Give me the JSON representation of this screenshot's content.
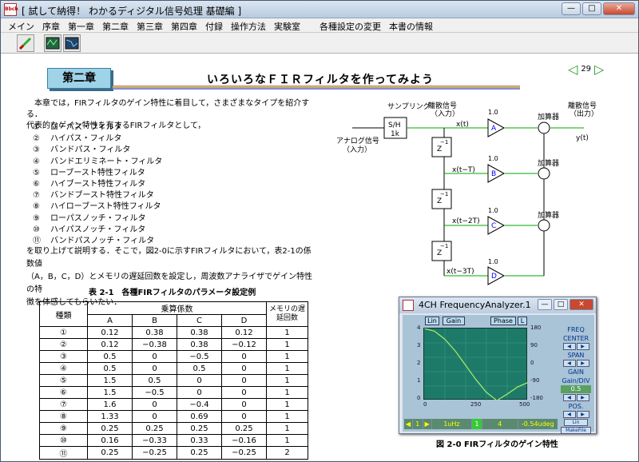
{
  "window": {
    "title": "[ 試して納得！ わかるディジタル信号処理 基礎編 ]",
    "app_icon_text": "Bbch",
    "min": "—",
    "max": "□",
    "close": "✕"
  },
  "menu": [
    {
      "label": "メイン"
    },
    {
      "label": "序章"
    },
    {
      "label": "第一章"
    },
    {
      "label": "第二章"
    },
    {
      "label": "第三章"
    },
    {
      "label": "第四章"
    },
    {
      "label": "付録"
    },
    {
      "label": "操作方法"
    },
    {
      "label": "実験室"
    },
    {
      "label": "各種設定の変更"
    },
    {
      "label": "本書の情報"
    }
  ],
  "page": {
    "chapter": "第二章",
    "title": "いろいろなＦＩＲフィルタを作ってみよう",
    "page_number": "29",
    "prev": "◁",
    "next": "▷"
  },
  "intro": [
    "本章では，FIRフィルタのゲイン特性に着目して，さまざまなタイプを紹介する．",
    "代表的なゲイン特性を有するFIRフィルタとして，"
  ],
  "filters": [
    {
      "n": "①",
      "name": "ローパス・フィルタ"
    },
    {
      "n": "②",
      "name": "ハイパス・フィルタ"
    },
    {
      "n": "③",
      "name": "バンドパス・フィルタ"
    },
    {
      "n": "④",
      "name": "バンドエリミネート・フィルタ"
    },
    {
      "n": "⑤",
      "name": "ローブースト特性フィルタ"
    },
    {
      "n": "⑥",
      "name": "ハイブースト特性フィルタ"
    },
    {
      "n": "⑦",
      "name": "バンドブースト特性フィルタ"
    },
    {
      "n": "⑧",
      "name": "ハイローブースト特性フィルタ"
    },
    {
      "n": "⑨",
      "name": "ローパスノッチ・フィルタ"
    },
    {
      "n": "⑩",
      "name": "ハイパスノッチ・フィルタ"
    },
    {
      "n": "⑪",
      "name": "バンドパスノッチ・フィルタ"
    }
  ],
  "after": [
    "を取り上げて説明する．そこで，図2-0に示すFIRフィルタにおいて，表2-1の係数値",
    "（A，B，C，D）とメモリの遅延回数を設定し，周波数アナライザでゲイン特性の特",
    "徴を体感してもらいたい．"
  ],
  "table": {
    "caption": "表 2-1　各種FIRフィルタのパラメータ設定例",
    "h_kind": "種類",
    "h_coef": "乗算係数",
    "h_mem": "メモリの遅延回数",
    "cols": [
      "A",
      "B",
      "C",
      "D"
    ],
    "rows": [
      [
        "①",
        "0.12",
        "0.38",
        "0.38",
        "0.12",
        "1"
      ],
      [
        "②",
        "0.12",
        "−0.38",
        "0.38",
        "−0.12",
        "1"
      ],
      [
        "③",
        "0.5",
        "0",
        "−0.5",
        "0",
        "1"
      ],
      [
        "④",
        "0.5",
        "0",
        "0.5",
        "0",
        "1"
      ],
      [
        "⑤",
        "1.5",
        "0.5",
        "0",
        "0",
        "1"
      ],
      [
        "⑥",
        "1.5",
        "−0.5",
        "0",
        "0",
        "1"
      ],
      [
        "⑦",
        "1.6",
        "0",
        "−0.4",
        "0",
        "1"
      ],
      [
        "⑧",
        "1.33",
        "0",
        "0.69",
        "0",
        "1"
      ],
      [
        "⑨",
        "0.25",
        "0.25",
        "0.25",
        "0.25",
        "1"
      ],
      [
        "⑩",
        "0.16",
        "−0.33",
        "0.33",
        "−0.16",
        "1"
      ],
      [
        "⑪",
        "0.25",
        "−0.25",
        "0.25",
        "−0.25",
        "2"
      ]
    ]
  },
  "diagram": {
    "sampling": "サンプリング",
    "sh": "S/H",
    "sh_rate": "1k",
    "analog": "アナログ信号",
    "analog_sub": "（入力）",
    "discrete_in": "離散信号",
    "discrete_in_sub": "（入力）",
    "discrete_out": "離散信号",
    "discrete_out_sub": "（出力）",
    "adder": "加算器",
    "memory": "メモリ",
    "z": "Z",
    "z_exp": "−1",
    "gain": "1.0",
    "xt": "x(t)",
    "xt1": "x(t−T)",
    "xt2": "x(t−2T)",
    "xt3": "x(t−3T)",
    "yt": "y(t)",
    "coef": [
      "A",
      "B",
      "C",
      "D"
    ]
  },
  "analyzer": {
    "title": "4CH FrequencyAnalyzer.1",
    "btn_lin": "Lin",
    "btn_gain": "Gain",
    "btn_phase": "Phase",
    "btn_l": "L",
    "y_left": [
      "4",
      "3",
      "2",
      "1",
      "0"
    ],
    "y_right": [
      "180",
      "90",
      "0",
      "-90",
      "-180"
    ],
    "x_ticks": [
      "0",
      "250",
      "500"
    ],
    "freq": "FREQ",
    "center": "CENTER",
    "span": "SPAN",
    "gain": "GAIN",
    "gain_div": "Gain/DIV",
    "gain_val": "0.5",
    "pos": "POS.",
    "lin2": "Lin",
    "makefile": "MakeFile",
    "status": [
      "1",
      "1uHz",
      "1",
      "4",
      "-0.54udeg"
    ],
    "caption": "図 2-0 FIRフィルタのゲイン特性"
  },
  "chart_data": {
    "type": "line",
    "title": "",
    "xlabel": "",
    "ylabel": "",
    "xlim": [
      0,
      500
    ],
    "ylim": [
      0,
      4
    ],
    "series": [
      {
        "x": [
          0,
          50,
          100,
          150,
          200,
          250,
          300,
          350,
          400,
          450,
          500
        ],
        "y": [
          4.0,
          3.85,
          3.4,
          2.75,
          1.95,
          1.15,
          0.45,
          0.0,
          0.35,
          0.75,
          1.0
        ]
      }
    ]
  }
}
